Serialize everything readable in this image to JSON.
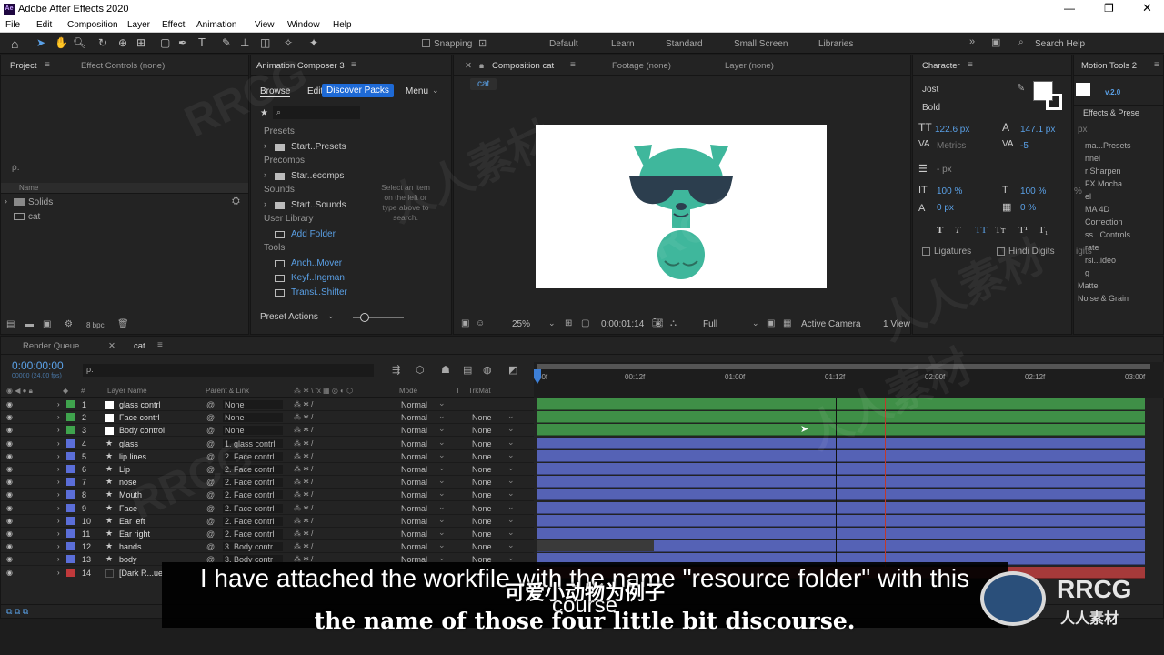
{
  "app": {
    "title": "Adobe After Effects 2020",
    "icon": "ae-logo-icon"
  },
  "menu": [
    "File",
    "Edit",
    "Composition",
    "Layer",
    "Effect",
    "Animation",
    "View",
    "Window",
    "Help"
  ],
  "toolbar": {
    "snapping": "Snapping",
    "workspaces": [
      "Default",
      "Learn",
      "Standard",
      "Small Screen",
      "Libraries"
    ],
    "search_placeholder": "Search Help"
  },
  "project_panel": {
    "tab": "Project",
    "effect_controls_tab": "Effect Controls (none)",
    "search_prefix": "ρ.",
    "column": "Name",
    "items": [
      "Solids",
      "cat"
    ],
    "bpc": "8 bpc"
  },
  "anim_composer": {
    "tab": "Animation Composer 3",
    "browse": "Browse",
    "edit": "Edit",
    "discover": "Discover Packs",
    "menu": "Menu",
    "groups": [
      {
        "title": "Presets",
        "item": "Start..Presets"
      },
      {
        "title": "Precomps",
        "item": "Star..ecomps"
      },
      {
        "title": "Sounds",
        "item": "Start..Sounds"
      },
      {
        "title": "User Library",
        "item": "Add Folder"
      },
      {
        "title": "Tools",
        "items": [
          "Anch..Mover",
          "Keyf..Ingman",
          "Transi..Shifter"
        ]
      }
    ],
    "hint": "Select an item on the left or type above to search.",
    "preset_actions": "Preset Actions"
  },
  "comp_panel": {
    "tab": "Composition cat",
    "footage_tab": "Footage (none)",
    "layer_tab": "Layer (none)",
    "crumb": "cat",
    "zoom": "25%",
    "timecode": "0:00:01:14",
    "resolution": "Full",
    "camera": "Active Camera",
    "views": "1 View"
  },
  "character": {
    "tab": "Character",
    "font": "Jost",
    "style": "Bold",
    "size": "122.6 px",
    "leading": "147.1 px",
    "kerning": "Metrics",
    "tracking": "-5",
    "stroke_unit": "- px",
    "vscale": "100 %",
    "hscale": "100 %",
    "baseline": "0 px",
    "tsume": "0 %",
    "ligatures": "Ligatures",
    "hindi": "Hindi Digits"
  },
  "motion_tools": {
    "tab": "Motion Tools 2",
    "version": "v.2.0",
    "effects_tab": "Effects & Prese",
    "effects": [
      "ma...Presets",
      "nnel",
      "r Sharpen",
      "FX Mocha",
      "el",
      "MA 4D",
      "Correction",
      "ss...Controls",
      "rate",
      "rsi...ideo",
      "g",
      "Matte",
      "Noise & Grain"
    ],
    "px_label": "px",
    "pct_label": "%",
    "digits": "igits"
  },
  "timeline": {
    "render_queue": "Render Queue",
    "comp_tab": "cat",
    "timecode": "0:00:00:00",
    "frame_info": "00000 (24.00 fps)",
    "columns": {
      "num": "#",
      "name": "Layer Name",
      "parent": "Parent & Link",
      "mode": "Mode",
      "t": "T",
      "trkmat": "TrkMat"
    },
    "ruler": [
      "00f",
      "00:12f",
      "01:00f",
      "01:12f",
      "02:00f",
      "02:12f",
      "03:00f"
    ],
    "layers": [
      {
        "num": "1",
        "name": "glass contrl",
        "parent": "None",
        "mode": "Normal",
        "trkmat": "",
        "color": "#3fa34d",
        "type": "null"
      },
      {
        "num": "2",
        "name": "Face contrl",
        "parent": "None",
        "mode": "Normal",
        "trkmat": "None",
        "color": "#3fa34d",
        "type": "null"
      },
      {
        "num": "3",
        "name": "Body control",
        "parent": "None",
        "mode": "Normal",
        "trkmat": "None",
        "color": "#3fa34d",
        "type": "null"
      },
      {
        "num": "4",
        "name": "glass",
        "parent": "1. glass contrl",
        "mode": "Normal",
        "trkmat": "None",
        "color": "#5b6ed8",
        "type": "shape"
      },
      {
        "num": "5",
        "name": "lip lines",
        "parent": "2. Face contrl",
        "mode": "Normal",
        "trkmat": "None",
        "color": "#5b6ed8",
        "type": "shape"
      },
      {
        "num": "6",
        "name": "Lip",
        "parent": "2. Face contrl",
        "mode": "Normal",
        "trkmat": "None",
        "color": "#5b6ed8",
        "type": "shape"
      },
      {
        "num": "7",
        "name": "nose",
        "parent": "2. Face contrl",
        "mode": "Normal",
        "trkmat": "None",
        "color": "#5b6ed8",
        "type": "shape"
      },
      {
        "num": "8",
        "name": "Mouth",
        "parent": "2. Face contrl",
        "mode": "Normal",
        "trkmat": "None",
        "color": "#5b6ed8",
        "type": "shape"
      },
      {
        "num": "9",
        "name": "Face",
        "parent": "2. Face contrl",
        "mode": "Normal",
        "trkmat": "None",
        "color": "#5b6ed8",
        "type": "shape"
      },
      {
        "num": "10",
        "name": "Ear left",
        "parent": "2. Face contrl",
        "mode": "Normal",
        "trkmat": "None",
        "color": "#5b6ed8",
        "type": "shape"
      },
      {
        "num": "11",
        "name": "Ear right",
        "parent": "2. Face contrl",
        "mode": "Normal",
        "trkmat": "None",
        "color": "#5b6ed8",
        "type": "shape"
      },
      {
        "num": "12",
        "name": "hands",
        "parent": "3. Body contr",
        "mode": "Normal",
        "trkmat": "None",
        "color": "#5b6ed8",
        "type": "shape"
      },
      {
        "num": "13",
        "name": "body",
        "parent": "3. Body contr",
        "mode": "Normal",
        "trkmat": "None",
        "color": "#5b6ed8",
        "type": "shape"
      },
      {
        "num": "14",
        "name": "[Dark R...ue",
        "parent": "",
        "mode": "",
        "trkmat": "",
        "color": "#c0393b",
        "type": "solid"
      }
    ]
  },
  "subtitle": {
    "line1": "I have attached the workfile with the name \"resource folder\" with this",
    "line2": "course",
    "cn": "可爱小动物为例子",
    "line3": "the name of those four little bit discourse."
  },
  "watermark": {
    "brand": "RRCG",
    "cn": "人人素材"
  }
}
